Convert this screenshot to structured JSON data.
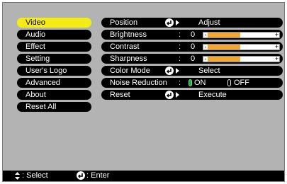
{
  "left_menu": {
    "items": [
      {
        "label": "Video",
        "active": true
      },
      {
        "label": "Audio",
        "active": false
      },
      {
        "label": "Effect",
        "active": false
      },
      {
        "label": "Setting",
        "active": false
      },
      {
        "label": "User's Logo",
        "active": false
      },
      {
        "label": "Advanced",
        "active": false
      },
      {
        "label": "About",
        "active": false
      },
      {
        "label": "Reset All",
        "active": false
      }
    ]
  },
  "settings": {
    "position": {
      "label": "Position",
      "action": "Adjust",
      "icon": "enter-icon"
    },
    "brightness": {
      "label": "Brightness",
      "colon": ":",
      "value": "0",
      "level": 0.5,
      "minus": "-",
      "plus": "+"
    },
    "contrast": {
      "label": "Contrast",
      "colon": ":",
      "value": "0",
      "level": 0.5,
      "minus": "-",
      "plus": "+"
    },
    "sharpness": {
      "label": "Sharpness",
      "colon": ":",
      "value": "0",
      "level": 0.5,
      "minus": "-",
      "plus": "+"
    },
    "color_mode": {
      "label": "Color Mode",
      "action": "Select",
      "icon": "enter-icon"
    },
    "noise_reduction": {
      "label": "Noise Reduction",
      "colon": ":",
      "on_label": "ON",
      "off_label": "OFF",
      "selected": "ON"
    },
    "reset": {
      "label": "Reset",
      "action": "Execute",
      "icon": "enter-icon"
    }
  },
  "status_bar": {
    "select_label": ": Select",
    "enter_label": ": Enter",
    "select_icon": "up-down-arrows-icon",
    "enter_icon": "enter-icon"
  },
  "colors": {
    "active_item": "#f5ec16",
    "slider_fill": "#f2a634",
    "radio_on": "#2aa84a",
    "background": "#b3b3b3"
  }
}
